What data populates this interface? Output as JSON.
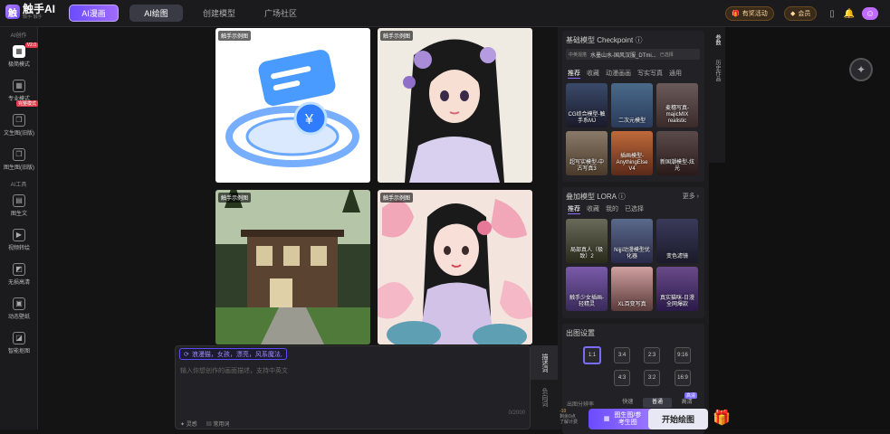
{
  "app": {
    "name": "触手AI",
    "subtitle": "触手·触手"
  },
  "nav": {
    "comic": "AI漫画",
    "draw": "AI绘图",
    "model": "创建模型",
    "community": "广场社区"
  },
  "top_right": {
    "gift_label": "有奖活动",
    "vip_label": "会员"
  },
  "sidebar": {
    "section_create": "AI创作",
    "items_create": [
      {
        "label": "极简模式",
        "tag": "V2.0",
        "icon": "image-icon"
      },
      {
        "label": "专业模式",
        "tag": "完整模式",
        "icon": "image-icon"
      },
      {
        "label": "文生图(旧版)",
        "icon": "copy-icon"
      },
      {
        "label": "图生图(旧版)",
        "icon": "copy-icon"
      }
    ],
    "section_tools": "AI工具",
    "items_tools": [
      {
        "label": "图生文",
        "icon": "doc-icon"
      },
      {
        "label": "视频转绘",
        "icon": "video-icon"
      },
      {
        "label": "无损高清",
        "icon": "enhance-icon"
      },
      {
        "label": "动态壁纸",
        "icon": "wallpaper-icon"
      },
      {
        "label": "智能抠图",
        "icon": "cutout-icon"
      }
    ]
  },
  "gallery": {
    "sample_label": "触手示例图"
  },
  "prompt": {
    "chip": "浪漫猫，女孩，漂亮，风系魔法,",
    "placeholder": "输入你想创作的画面描述，支持中英文",
    "count": "0/2000",
    "inspiration": "灵感",
    "common_words": "常用词"
  },
  "vtabs": {
    "describe": "描述词",
    "negative": "负向词"
  },
  "base_model": {
    "title": "基础模型 Checkpoint",
    "search_hint": "中英混搭",
    "selected": "水墨山水-国风汉服_DTmi...",
    "selected_tag": "已选择",
    "tabs": [
      "推荐",
      "收藏",
      "动漫画画",
      "写实写真",
      "通用"
    ],
    "models": [
      {
        "name": "CG综合模型-触手系MJ",
        "badge": "全能王"
      },
      {
        "name": "二次元模型",
        "badge": ""
      },
      {
        "name": "麦穗写真-majicMIX realistic",
        "badge": "全能王"
      },
      {
        "name": "超写实模型-中古写真3",
        "badge": ""
      },
      {
        "name": "插画模型-AnythingElse V4",
        "badge": ""
      },
      {
        "name": "新国潮模型-炫光",
        "badge": ""
      }
    ]
  },
  "lora": {
    "title": "叠加模型 LORA",
    "more": "更多",
    "tabs": [
      "推荐",
      "收藏",
      "我的",
      "已选择"
    ],
    "models": [
      {
        "name": "局部真人（极致）2"
      },
      {
        "name": "Nijji动漫模型优化器"
      },
      {
        "name": "变色滤镜"
      },
      {
        "name": "触手少女插画-轻精灵"
      },
      {
        "name": "XL百变写真"
      },
      {
        "name": "真实猫咪-日漫全网爆款"
      }
    ]
  },
  "output": {
    "title": "出图设置",
    "ratios": [
      "1:1",
      "3:4",
      "2:3",
      "9:16",
      "4:3",
      "3:2",
      "16:9"
    ],
    "selected_ratio": "1:1",
    "resolution_label": "出图分辨率",
    "speed": [
      "快速",
      "普通",
      "高清"
    ],
    "speed_badge": "高清"
  },
  "right_tabs": {
    "params": "参数",
    "history": "历史作品"
  },
  "actions": {
    "gen_label": "图生图/参考生图",
    "start": "开始绘图",
    "credits_line1": "-10",
    "credits_line2": "剩余0点",
    "credits_line3": "了解计费"
  },
  "colors": {
    "accent": "#7a6bff",
    "bg": "#141414",
    "panel": "#1c1c1f"
  }
}
